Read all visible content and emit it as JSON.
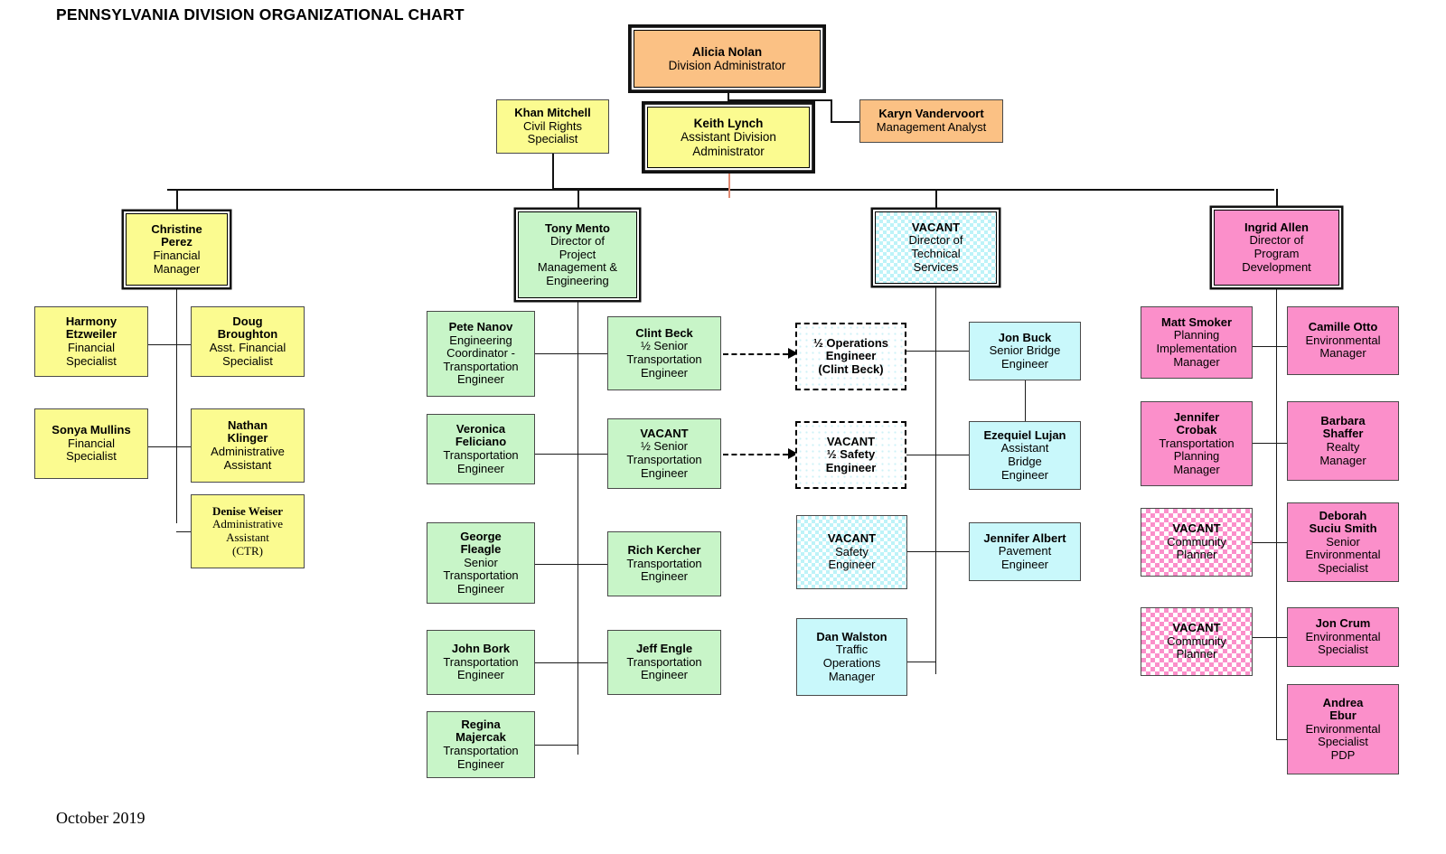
{
  "page": {
    "title": "PENNSYLVANIA DIVISION ORGANIZATIONAL CHART",
    "date": "October 2019"
  },
  "colors": {
    "administrator": "#fbc184",
    "financial": "#fbfb90",
    "engineering": "#c8f5c8",
    "technical": "#c9f8fb",
    "program": "#fb8fca",
    "connector": "#1b1b1b",
    "highlight_connector": "#e08a72"
  },
  "executive": {
    "administrator": {
      "name": "Alicia Nolan",
      "title": [
        "Division Administrator"
      ]
    },
    "assistant": {
      "name": "Keith Lynch",
      "title": [
        "Assistant Division",
        "Administrator"
      ]
    },
    "civil_rights": {
      "name": "Khan Mitchell",
      "title": [
        "Civil Rights",
        "Specialist"
      ]
    },
    "management_analyst": {
      "name": "Karyn Vandervoort",
      "title": [
        "Management Analyst"
      ]
    }
  },
  "divisions": {
    "financial": {
      "head": {
        "name": "Christine Perez",
        "name_lines": [
          "Christine",
          "Perez"
        ],
        "title": [
          "Financial",
          "Manager"
        ]
      },
      "left": [
        {
          "name_lines": [
            "Harmony",
            "Etzweiler"
          ],
          "title": [
            "Financial",
            "Specialist"
          ]
        },
        {
          "name_lines": [
            "Sonya Mullins"
          ],
          "title": [
            "Financial",
            "Specialist"
          ]
        }
      ],
      "right": [
        {
          "name_lines": [
            "Doug",
            "Broughton"
          ],
          "title": [
            "Asst. Financial",
            "Specialist"
          ]
        },
        {
          "name_lines": [
            "Nathan",
            "Klinger"
          ],
          "title": [
            "Administrative",
            "Assistant"
          ]
        },
        {
          "name_lines": [
            "Denise Weiser"
          ],
          "title": [
            "Administrative",
            "Assistant",
            "(CTR)"
          ],
          "serif": true
        }
      ]
    },
    "engineering": {
      "head": {
        "name": "Tony Mento",
        "name_lines": [
          "Tony Mento"
        ],
        "title": [
          "Director of",
          "Project",
          "Management &",
          "Engineering"
        ]
      },
      "left": [
        {
          "name_lines": [
            "Pete Nanov"
          ],
          "title": [
            "Engineering",
            "Coordinator -",
            "Transportation",
            "Engineer"
          ]
        },
        {
          "name_lines": [
            "Veronica",
            "Feliciano"
          ],
          "title": [
            "Transportation",
            "Engineer"
          ]
        },
        {
          "name_lines": [
            "George",
            "Fleagle"
          ],
          "title": [
            "Senior",
            "Transportation",
            "Engineer"
          ]
        },
        {
          "name_lines": [
            "John Bork"
          ],
          "title": [
            "Transportation",
            "Engineer"
          ]
        },
        {
          "name_lines": [
            "Regina",
            "Majercak"
          ],
          "title": [
            "Transportation",
            "Engineer"
          ]
        }
      ],
      "right": [
        {
          "name_lines": [
            "Clint Beck"
          ],
          "title": [
            "½ Senior",
            "Transportation",
            "Engineer"
          ]
        },
        {
          "name_lines": [
            "VACANT"
          ],
          "title": [
            "½ Senior",
            "Transportation",
            "Engineer"
          ]
        },
        {
          "name_lines": [
            "Rich Kercher"
          ],
          "title": [
            "Transportation",
            "Engineer"
          ]
        },
        {
          "name_lines": [
            "Jeff Engle"
          ],
          "title": [
            "Transportation",
            "Engineer"
          ]
        }
      ]
    },
    "technical": {
      "head": {
        "name": "VACANT",
        "name_lines": [
          "VACANT"
        ],
        "title": [
          "Director of",
          "Technical",
          "Services"
        ],
        "vacant": true
      },
      "dashed": [
        {
          "name_lines": [
            "½ Operations",
            "Engineer",
            "(Clint Beck)"
          ],
          "title": []
        },
        {
          "name_lines": [
            "VACANT",
            "½ Safety",
            "Engineer"
          ],
          "title": []
        }
      ],
      "left": [
        {
          "name_lines": [
            "VACANT"
          ],
          "title": [
            "Safety",
            "Engineer"
          ],
          "vacant": true
        },
        {
          "name_lines": [
            "Dan Walston"
          ],
          "title": [
            "Traffic",
            "Operations",
            "Manager"
          ]
        }
      ],
      "right": [
        {
          "name_lines": [
            "Jon Buck"
          ],
          "title": [
            "Senior Bridge",
            "Engineer"
          ]
        },
        {
          "name_lines": [
            "Ezequiel Lujan"
          ],
          "title": [
            "Assistant",
            "Bridge",
            "Engineer"
          ]
        },
        {
          "name_lines": [
            "Jennifer Albert"
          ],
          "title": [
            "Pavement",
            "Engineer"
          ]
        }
      ]
    },
    "program": {
      "head": {
        "name": "Ingrid Allen",
        "name_lines": [
          "Ingrid Allen"
        ],
        "title": [
          "Director of",
          "Program",
          "Development"
        ]
      },
      "left": [
        {
          "name_lines": [
            "Matt Smoker"
          ],
          "title": [
            "Planning",
            "Implementation",
            "Manager"
          ]
        },
        {
          "name_lines": [
            "Jennifer",
            "Crobak"
          ],
          "title": [
            "Transportation",
            "Planning",
            "Manager"
          ]
        },
        {
          "name_lines": [
            "VACANT"
          ],
          "title": [
            "Community",
            "Planner"
          ],
          "vacant": true
        },
        {
          "name_lines": [
            "VACANT"
          ],
          "title": [
            "Community",
            "Planner"
          ],
          "vacant": true
        }
      ],
      "right": [
        {
          "name_lines": [
            "Camille Otto"
          ],
          "title": [
            "Environmental",
            "Manager"
          ]
        },
        {
          "name_lines": [
            "Barbara",
            "Shaffer"
          ],
          "title": [
            "Realty",
            "Manager"
          ]
        },
        {
          "name_lines": [
            "Deborah",
            "Suciu Smith"
          ],
          "title": [
            "Senior",
            "Environmental",
            "Specialist"
          ]
        },
        {
          "name_lines": [
            "Jon Crum"
          ],
          "title": [
            "Environmental",
            "Specialist"
          ]
        },
        {
          "name_lines": [
            "Andrea",
            "Ebur"
          ],
          "title": [
            "Environmental",
            "Specialist",
            "PDP"
          ]
        }
      ]
    }
  }
}
